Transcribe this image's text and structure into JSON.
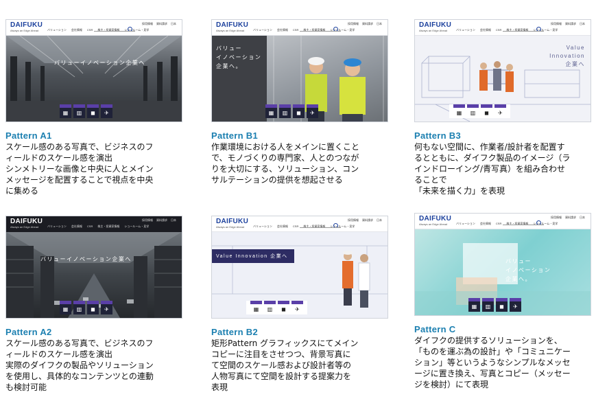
{
  "header": {
    "logo": "DAIFUKU",
    "tagline": "Always an Edge Ahead",
    "nav": [
      "バリューション",
      "会社情報",
      "CSR",
      "株主・投資家情報",
      "ショールーム・見学"
    ],
    "util": [
      "採用情報",
      "資料請求",
      "日本"
    ]
  },
  "icons": [
    "▦",
    "▥",
    "◼",
    "✈"
  ],
  "patterns": [
    {
      "title": "Pattern A1",
      "hero_text": "バリューイノベーション企業へ",
      "description": "スケール感のある写真で、ビジネスのフ\nィールドのスケール感を演出\nシンメトリーな画像と中央に人とメイン\nメッセージを配置することで視点を中央\nに集める"
    },
    {
      "title": "Pattern B1",
      "hero_text": "バリュー\nイノベーション\n企業へ。",
      "description": "作業環境における人をメインに置くこと\nで、モノづくりの専門家、人とのつなが\nりを大切にする、ソリューション、コン\nサルテーションの提供を想起させる"
    },
    {
      "title": "Pattern B3",
      "hero_text": "Value\nInnovation\n企業へ",
      "description": "何もない空間に、作業者/設計者を配置す\nるとともに、ダイフク製品のイメージ（ラ\nインドローイング/青写真）を組み合わせ\nることで\n「未来を描く力」を表現"
    },
    {
      "title": "Pattern A2",
      "hero_text": "バリューイノベーション企業へ",
      "description": "スケール感のある写真で、ビジネスのフ\nィールドのスケール感を演出\n実際のダイフクの製品やソリューション\nを使用し、具体的なコンテンツとの連動\nも検討可能"
    },
    {
      "title": "Pattern B2",
      "hero_text": "Value Innovation 企業へ",
      "description": "矩形Pattern グラフィックスにてメイン\nコピーに注目をさせつつ、背景写真に\nて空間のスケール感および設計者等の\n人物写真にて空間を設計する提案力を\n表現"
    },
    {
      "title": "Pattern C",
      "hero_text": "バリュー\nイノベーション\n企業へ。",
      "description": "ダイフクの提供するソリューションを、\n「ものを運ぶ為の設計」や「コミュニケー\nション」等というようなシンプルなメッセ\nージに置き換え、写真とコピー（メッセー\nジを検討）にて表現"
    }
  ]
}
